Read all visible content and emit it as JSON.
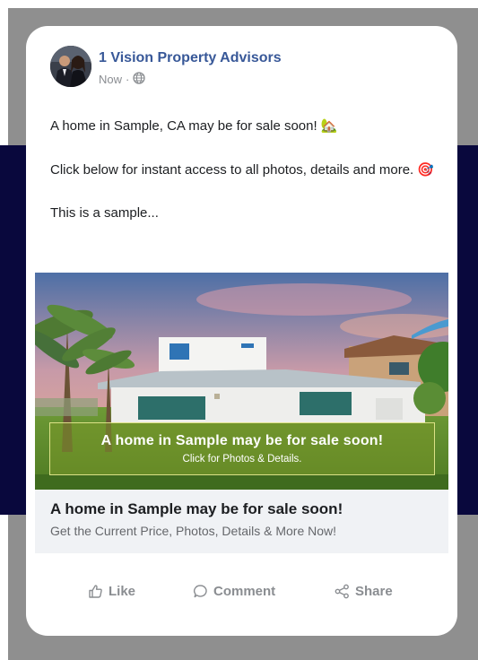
{
  "post": {
    "page_name": "1 Vision Property Advisors",
    "timestamp": "Now",
    "separator": "·",
    "audience_icon": "globe-icon",
    "text_lines": [
      "A home in Sample, CA may be for sale soon! 🏡",
      "Click below for instant access to all photos, details and more. 🎯",
      "This is a sample..."
    ]
  },
  "media": {
    "overlay_title": "A home in Sample may be for sale soon!",
    "overlay_subtitle": "Click for Photos & Details."
  },
  "link_preview": {
    "title": "A home in Sample may be for sale soon!",
    "description": "Get the Current Price, Photos, Details & More Now!"
  },
  "actions": {
    "like": "Like",
    "comment": "Comment",
    "share": "Share"
  },
  "colors": {
    "page_name": "#385898",
    "backdrop": "#8f8f8f",
    "band": "#09083d",
    "action_text": "#8a8d91"
  }
}
